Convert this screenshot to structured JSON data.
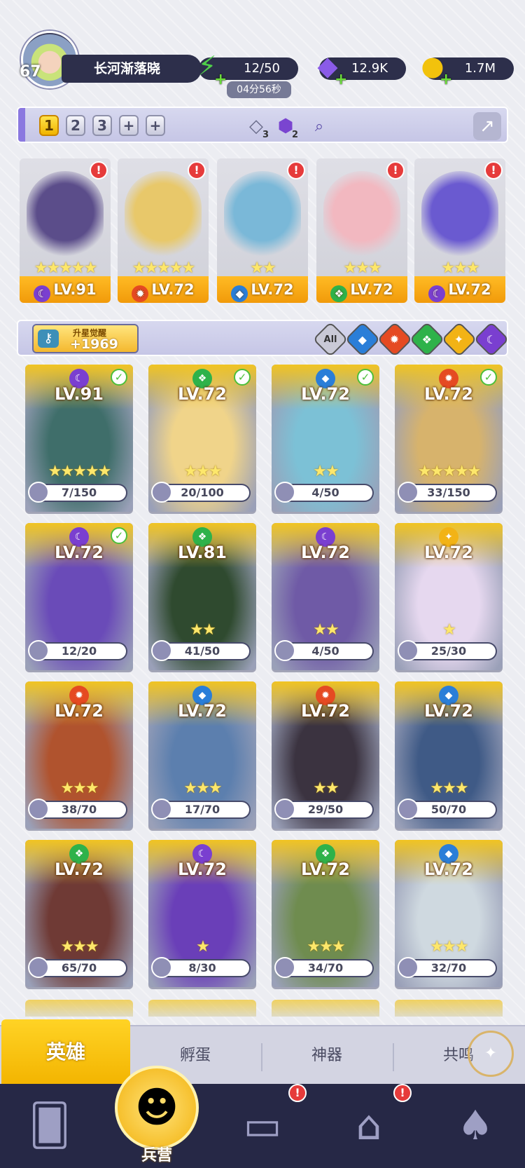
{
  "player": {
    "level": "67",
    "name": "长河渐落晓"
  },
  "resources": [
    {
      "name": "energy",
      "value": "12/50",
      "icon": "lightning-icon"
    },
    {
      "name": "gems",
      "value": "12.9K",
      "icon": "gem-icon"
    },
    {
      "name": "gold",
      "value": "1.7M",
      "icon": "coin-icon"
    }
  ],
  "timer": "04分56秒",
  "team_tabs": [
    "1",
    "2",
    "3",
    "+",
    "+"
  ],
  "team_filter_counts": [
    "3",
    "2"
  ],
  "team_slots": [
    {
      "level": "LV.91",
      "stars": "★★★★★",
      "element": "☾",
      "color": "#5b4d8a"
    },
    {
      "level": "LV.72",
      "stars": "★★★★★",
      "element": "✹",
      "color": "#e8c86a"
    },
    {
      "level": "LV.72",
      "stars": "★★",
      "element": "◆",
      "color": "#7ab8d8"
    },
    {
      "level": "LV.72",
      "stars": "★★★",
      "element": "❖",
      "color": "#f2b8c0"
    },
    {
      "level": "LV.72",
      "stars": "★★★",
      "element": "☾",
      "color": "#6a5ad0"
    }
  ],
  "awaken": {
    "label": "升星觉醒",
    "value": "+1969"
  },
  "filters": [
    "All",
    "water",
    "fire",
    "nature",
    "light",
    "dark"
  ],
  "heroes": [
    {
      "level": "LV.91",
      "progress": "7/150",
      "stars": "★★★★★",
      "element": "☾",
      "check": true
    },
    {
      "level": "LV.72",
      "progress": "20/100",
      "stars": "★★★",
      "element": "❖",
      "check": true
    },
    {
      "level": "LV.72",
      "progress": "4/50",
      "stars": "★★",
      "element": "◆",
      "check": true
    },
    {
      "level": "LV.72",
      "progress": "33/150",
      "stars": "★★★★★",
      "element": "✹",
      "check": true
    },
    {
      "level": "LV.72",
      "progress": "12/20",
      "stars": "",
      "element": "☾",
      "check": true
    },
    {
      "level": "LV.81",
      "progress": "41/50",
      "stars": "★★",
      "element": "❖",
      "check": false
    },
    {
      "level": "LV.72",
      "progress": "4/50",
      "stars": "★★",
      "element": "☾",
      "check": false
    },
    {
      "level": "LV.72",
      "progress": "25/30",
      "stars": "★",
      "element": "✦",
      "check": false
    },
    {
      "level": "LV.72",
      "progress": "38/70",
      "stars": "★★★",
      "element": "✹",
      "check": false
    },
    {
      "level": "LV.72",
      "progress": "17/70",
      "stars": "★★★",
      "element": "◆",
      "check": false
    },
    {
      "level": "LV.72",
      "progress": "29/50",
      "stars": "★★",
      "element": "✹",
      "check": false
    },
    {
      "level": "LV.72",
      "progress": "50/70",
      "stars": "★★★",
      "element": "◆",
      "check": false
    },
    {
      "level": "LV.72",
      "progress": "65/70",
      "stars": "★★★",
      "element": "❖",
      "check": false
    },
    {
      "level": "LV.72",
      "progress": "8/30",
      "stars": "★",
      "element": "☾",
      "check": false
    },
    {
      "level": "LV.72",
      "progress": "34/70",
      "stars": "★★★",
      "element": "❖",
      "check": false
    },
    {
      "level": "LV.72",
      "progress": "32/70",
      "stars": "★★★",
      "element": "◆",
      "check": false
    }
  ],
  "tabs": [
    "英雄",
    "孵蛋",
    "神器",
    "共鸣"
  ],
  "nav": {
    "active_label": "兵营"
  },
  "colors": {
    "accent": "#f3b400",
    "dark": "#262846",
    "alert": "#e63b3b"
  }
}
